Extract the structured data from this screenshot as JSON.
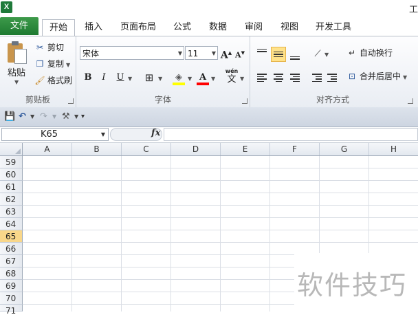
{
  "window": {
    "title_fragment": "工"
  },
  "tabs": [
    {
      "label": "文件",
      "active": false,
      "kind": "file"
    },
    {
      "label": "开始",
      "active": true
    },
    {
      "label": "插入",
      "active": false
    },
    {
      "label": "页面布局",
      "active": false
    },
    {
      "label": "公式",
      "active": false
    },
    {
      "label": "数据",
      "active": false
    },
    {
      "label": "审阅",
      "active": false
    },
    {
      "label": "视图",
      "active": false
    },
    {
      "label": "开发工具",
      "active": false
    }
  ],
  "ribbon": {
    "clipboard": {
      "label": "剪贴板",
      "paste": "粘贴",
      "cut": "剪切",
      "copy": "复制",
      "format_painter": "格式刷"
    },
    "font": {
      "label": "字体",
      "font_name": "宋体",
      "font_size": "11",
      "bold": "B",
      "italic": "I",
      "underline": "U",
      "grow": "A",
      "shrink": "A",
      "font_color_letter": "A",
      "phonetic": "wén",
      "phonetic_char": "文",
      "font_color": "#ff0000",
      "fill_color": "#ffff00"
    },
    "alignment": {
      "label": "对齐方式",
      "wrap_text": "自动换行",
      "merge_center": "合并后居中"
    }
  },
  "formula_bar": {
    "name_box": "K65",
    "fx": "fx",
    "formula": ""
  },
  "grid": {
    "columns": [
      "A",
      "B",
      "C",
      "D",
      "E",
      "F",
      "G",
      "H"
    ],
    "rows": [
      "59",
      "60",
      "61",
      "62",
      "63",
      "64",
      "65",
      "66",
      "67",
      "68",
      "69",
      "70",
      "71"
    ],
    "active_row": "65"
  },
  "watermark": {
    "text": "软件技巧"
  },
  "colors": {
    "file_tab": "#1e7a31",
    "active_row_header": "#f9d78a",
    "selected_align": "#ffe28a"
  }
}
